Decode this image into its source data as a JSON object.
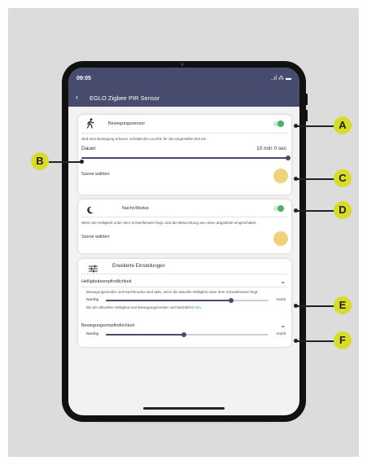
{
  "status": {
    "time": "09:05",
    "icons": "..ıl ⁂ ▬"
  },
  "nav": {
    "back": "‹",
    "title": "EGLO Zigbee PIR Sensor"
  },
  "motion": {
    "title": "Bewegungssensor",
    "description": "wird eine Bewegung erkannt, schaltet die Leuchte für die eingestellte Zeit ein",
    "duration_label": "Dauer",
    "duration_value": "10 min 0 sec",
    "duration_fraction": 1.0,
    "scene_label": "Szene wählen",
    "toggle_on": true
  },
  "night": {
    "title": "Nacht-Modus",
    "description": "Wenn die Helligkeit unter dem Schwellenwert liegt, wird die Beleuchtung wie unten abgebildet eingeschaltet.",
    "scene_label": "Szene wählen",
    "toggle_on": true
  },
  "advanced": {
    "title": "Erweiterte Einstellungen",
    "brightness": {
      "title": "Helligkeitsempfindlichkeit",
      "description": "Bewegungsmelder und Nachtmodus sind aktiv, wenn die aktuelle Helligkeit unter dem Schwellenwert liegt.",
      "low": "Niedrig",
      "high": "Hoch",
      "fraction": 0.77,
      "status_prefix": "Bei der aktuellen Helligkeit sind Bewegungsmelder und Nachtlicht",
      "status_value": "Aktiv"
    },
    "motion_sens": {
      "title": "Bewegungsempfindlichkeit",
      "low": "Niedrig",
      "high": "Hoch",
      "fraction": 0.48
    }
  },
  "callouts": {
    "a": "A",
    "b": "B",
    "c": "C",
    "d": "D",
    "e": "E",
    "f": "F"
  },
  "colors": {
    "header": "#474b6e",
    "accent_green": "#4caf6a",
    "scene": "#f1d27c",
    "callout": "#d7dc2a"
  }
}
